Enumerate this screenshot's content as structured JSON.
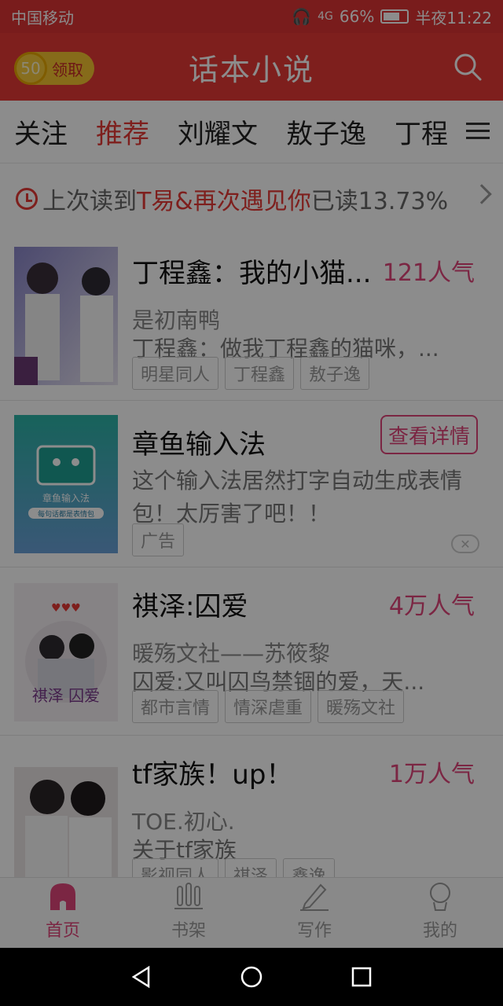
{
  "status_bar": {
    "carrier": "中国移动",
    "network": "4G",
    "battery": "66%",
    "time": "半夜11:22"
  },
  "header": {
    "coin_amount": "50",
    "coin_label": "领取",
    "title": "话本小说"
  },
  "tabs": [
    "关注",
    "推荐",
    "刘耀文",
    "敖子逸",
    "丁程"
  ],
  "last_read": {
    "prefix": "上次读到",
    "title": "T易&再次遇见你",
    "suffix": "已读13.73%"
  },
  "feed": [
    {
      "title": "丁程鑫：我的小猫...",
      "popularity": "121人气",
      "author": "是初南鸭",
      "description": "丁程鑫：做我丁程鑫的猫咪，...",
      "tags": [
        "明星同人",
        "丁程鑫",
        "敖子逸"
      ]
    },
    {
      "title": "章鱼输入法",
      "button": "查看详情",
      "description_line1": "这个输入法居然打字自动生成表情",
      "description_line2": "包！太厉害了吧！！",
      "tag": "广告",
      "cover_text": "章鱼输入法",
      "cover_subtext": "每句话都是表情包"
    },
    {
      "title": "祺泽:囚爱",
      "popularity": "4万人气",
      "author": "暖殇文社——苏筱黎",
      "description": "囚爱:又叫囚鸟禁锢的爱，天...",
      "tags": [
        "都市言情",
        "情深虐重",
        "暖殇文社"
      ],
      "cover_text": "祺泽 囚爱"
    },
    {
      "title": "tf家族！up！",
      "popularity": "1万人气",
      "author": "TOE.初心.",
      "description": "关于tf家族",
      "tags": [
        "影视同人",
        "祺泽",
        "鑫逸"
      ]
    }
  ],
  "bottom_nav": [
    "首页",
    "书架",
    "写作",
    "我的"
  ],
  "colors": {
    "accent_red": "#e53935",
    "pink": "#e0457b"
  }
}
